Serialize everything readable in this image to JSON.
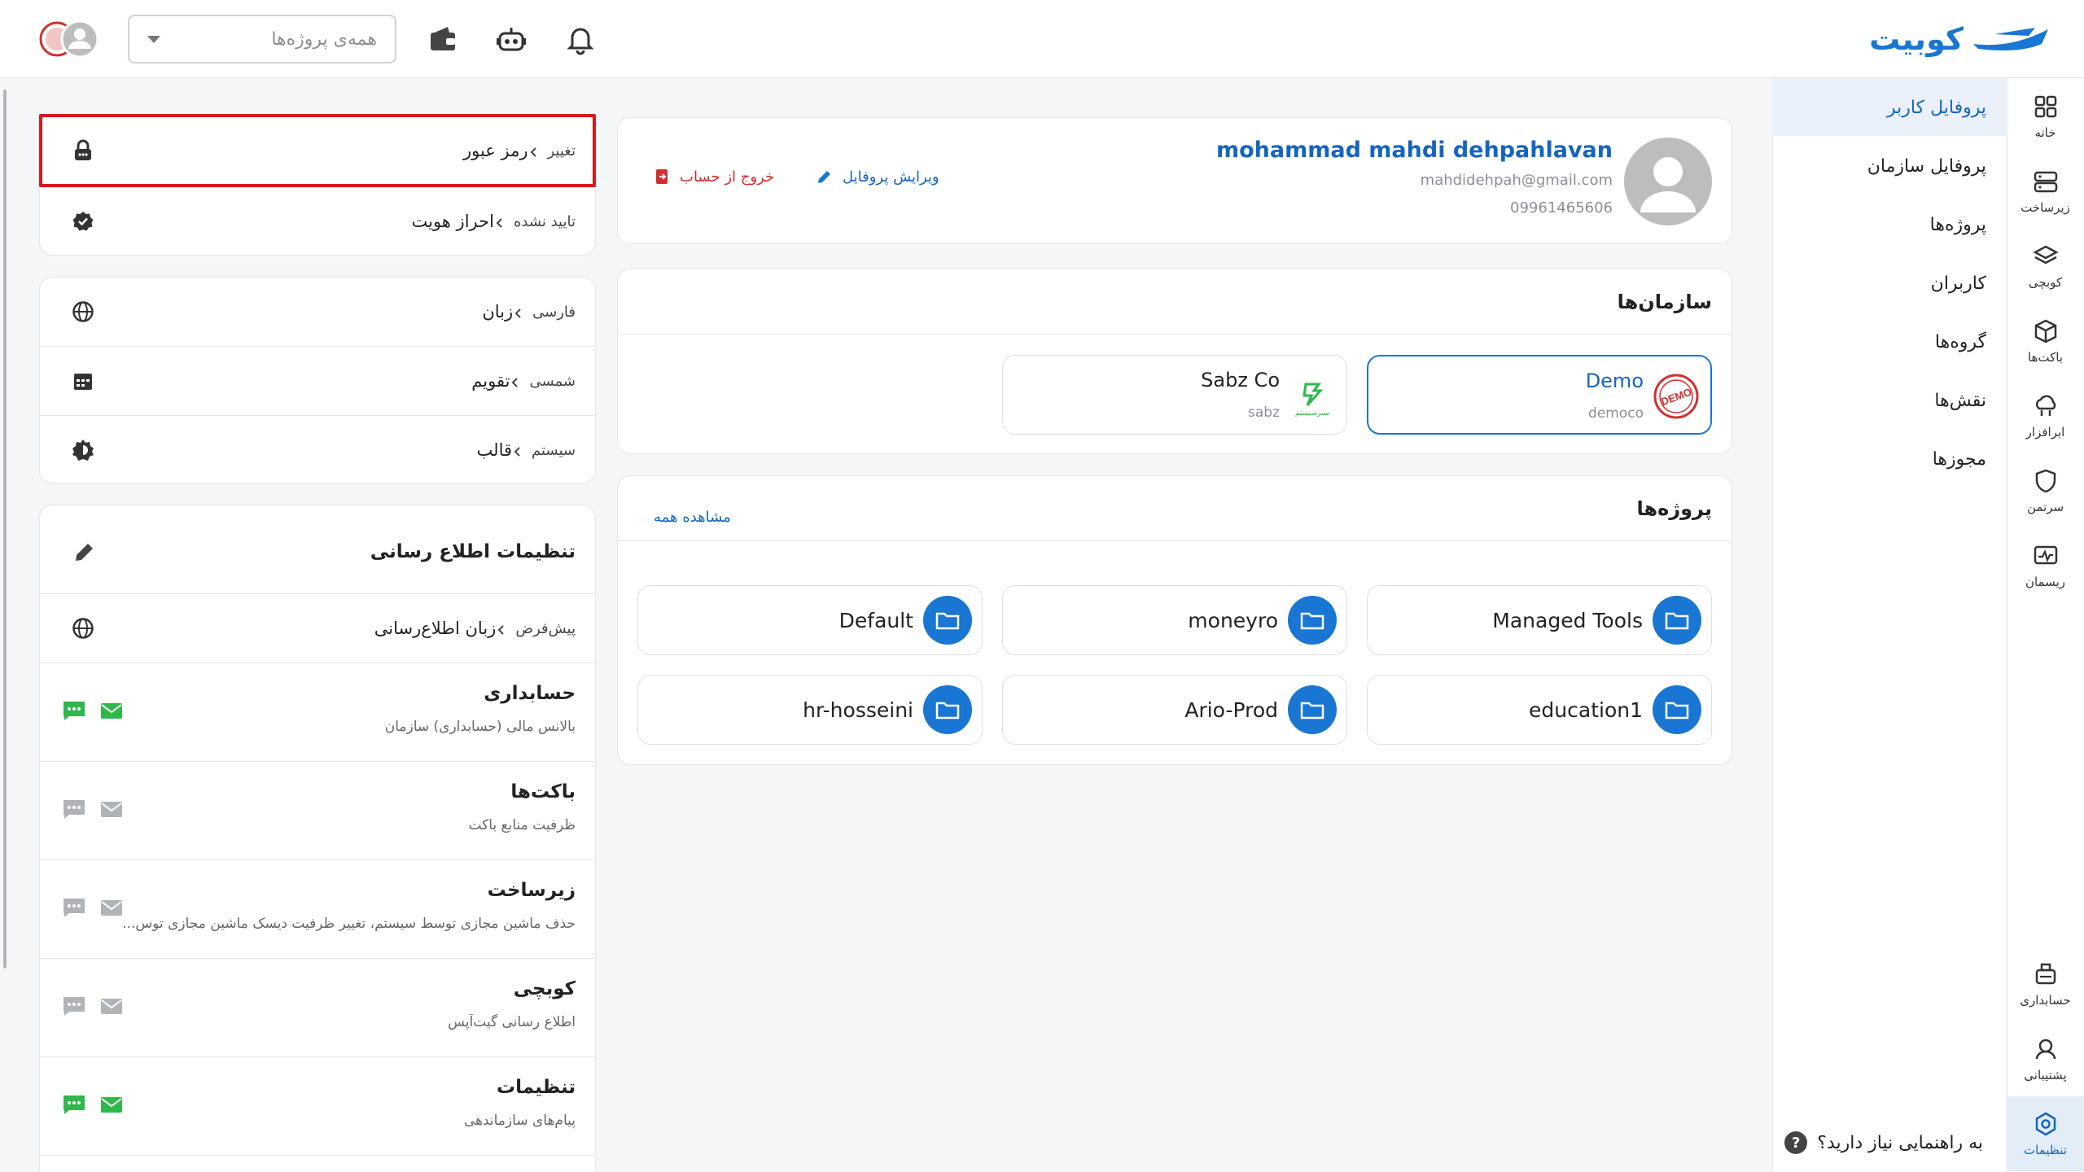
{
  "header": {
    "brand": "کوبیت",
    "project_select": {
      "placeholder": "همه‌ی پروژه‌ها"
    }
  },
  "sidebar": {
    "items": [
      {
        "label": "خانه",
        "icon": "grid-icon"
      },
      {
        "label": "زیرساخت",
        "icon": "server-icon"
      },
      {
        "label": "کوبچی",
        "icon": "layers-icon"
      },
      {
        "label": "باکت‌ها",
        "icon": "cube-icon"
      },
      {
        "label": "ابرافزار",
        "icon": "cloud-app-icon"
      },
      {
        "label": "سرتمن",
        "icon": "shield-icon"
      },
      {
        "label": "ریسمان",
        "icon": "monitor-icon"
      },
      {
        "label": "حسابداری",
        "icon": "accounting-icon"
      },
      {
        "label": "پشتیبانی",
        "icon": "support-icon"
      },
      {
        "label": "تنظیمات",
        "icon": "settings-icon"
      }
    ]
  },
  "subnav": {
    "items": [
      "پروفایل کاربر",
      "پروفایل سازمان",
      "پروژه‌ها",
      "کاربران",
      "گروه‌ها",
      "نقش‌ها",
      "مجوزها"
    ],
    "help": "به راهنمایی نیاز دارید؟"
  },
  "profile": {
    "name": "mohammad mahdi dehpahlavan",
    "email": "mahdidehpah@gmail.com",
    "phone": "09961465606",
    "edit_label": "ویرایش پروفایل",
    "logout_label": "خروج از حساب"
  },
  "orgs": {
    "title": "سازمان‌ها",
    "items": [
      {
        "name": "Demo",
        "sub": "democo",
        "logo": "DEMO"
      },
      {
        "name": "Sabz Co",
        "sub": "sabz",
        "logo": "سبزسیستم"
      }
    ]
  },
  "projects": {
    "title": "پروژه‌ها",
    "see_all": "مشاهده همه",
    "items": [
      "Managed Tools",
      "moneyro",
      "Default",
      "education1",
      "Ario-Prod",
      "hr-hosseini"
    ]
  },
  "security": {
    "password": {
      "label": "رمز عبور",
      "value": "تغییر"
    },
    "identity": {
      "label": "احراز هویت",
      "value": "تایید نشده"
    }
  },
  "prefs": {
    "language": {
      "label": "زبان",
      "value": "فارسی"
    },
    "calendar": {
      "label": "تقویم",
      "value": "شمسی"
    },
    "theme": {
      "label": "قالب",
      "value": "سیستم"
    }
  },
  "notifications": {
    "title": "تنظیمات اطلاع رسانی",
    "language": {
      "label": "زبان اطلاع‌رسانی",
      "value": "پیش‌فرض"
    },
    "items": [
      {
        "title": "حسابداری",
        "desc": "بالانس مالی (حسابداری) سازمان",
        "enabled": true
      },
      {
        "title": "باکت‌ها",
        "desc": "ظرفیت منابع باکت",
        "enabled": false
      },
      {
        "title": "زیرساخت",
        "desc": "حذف ماشین مجازی توسط سیستم، تغییر ظرفیت دیسک ماشین مجازی توس...",
        "enabled": false
      },
      {
        "title": "کوبچی",
        "desc": "اطلاع رسانی گیت‌آپس",
        "enabled": false
      },
      {
        "title": "تنظیمات",
        "desc": "پیام‌های سازماندهی",
        "enabled": true
      }
    ]
  },
  "colors": {
    "accent": "#1976d2",
    "danger": "#d32f2f",
    "success": "#2eb84b",
    "muted": "#b0b4b8"
  }
}
